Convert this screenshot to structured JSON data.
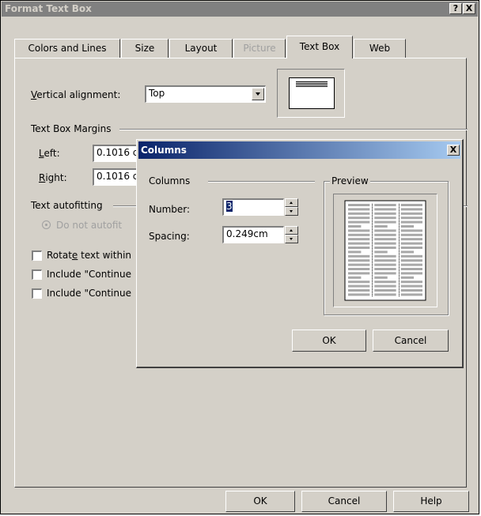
{
  "window": {
    "title": "Format Text Box",
    "help_btn": "?",
    "close_btn": "X"
  },
  "tabs": [
    {
      "label": "Colors and Lines",
      "state": "normal"
    },
    {
      "label": "Size",
      "state": "normal"
    },
    {
      "label": "Layout",
      "state": "normal"
    },
    {
      "label": "Picture",
      "state": "disabled"
    },
    {
      "label": "Text Box",
      "state": "active"
    },
    {
      "label": "Web",
      "state": "normal"
    }
  ],
  "textbox_tab": {
    "vertical_alignment": {
      "label_u": "V",
      "label_rest": "ertical alignment:",
      "value": "Top"
    },
    "margins_group": "Text Box Margins",
    "left": {
      "label_u": "L",
      "label_rest": "eft:",
      "value": "0.1016 c"
    },
    "right": {
      "label_u": "R",
      "label_rest": "ight:",
      "value": "0.1016 c"
    },
    "autofit_group": "Text autofitting",
    "do_not_autofit": "Do not autofit",
    "rotate": {
      "pre": "Rotat",
      "u": "e",
      "post": " text within"
    },
    "include1": "Include \"Continue",
    "include2": "Include \"Continue"
  },
  "bottom_buttons": {
    "ok": "OK",
    "cancel": "Cancel",
    "help": "Help"
  },
  "columns_dialog": {
    "title": "Columns",
    "close_btn": "X",
    "group": "Columns",
    "number_label": "Number:",
    "number_value": "3",
    "spacing_label": "Spacing:",
    "spacing_value": "0.249cm",
    "preview_label": "Preview",
    "ok": "OK",
    "cancel": "Cancel"
  },
  "colors": {
    "face": "#d4d0c8",
    "inactive_title": "#808080",
    "active_title_start": "#0a246a",
    "active_title_end": "#a6caf0",
    "selection": "#0a246a"
  }
}
